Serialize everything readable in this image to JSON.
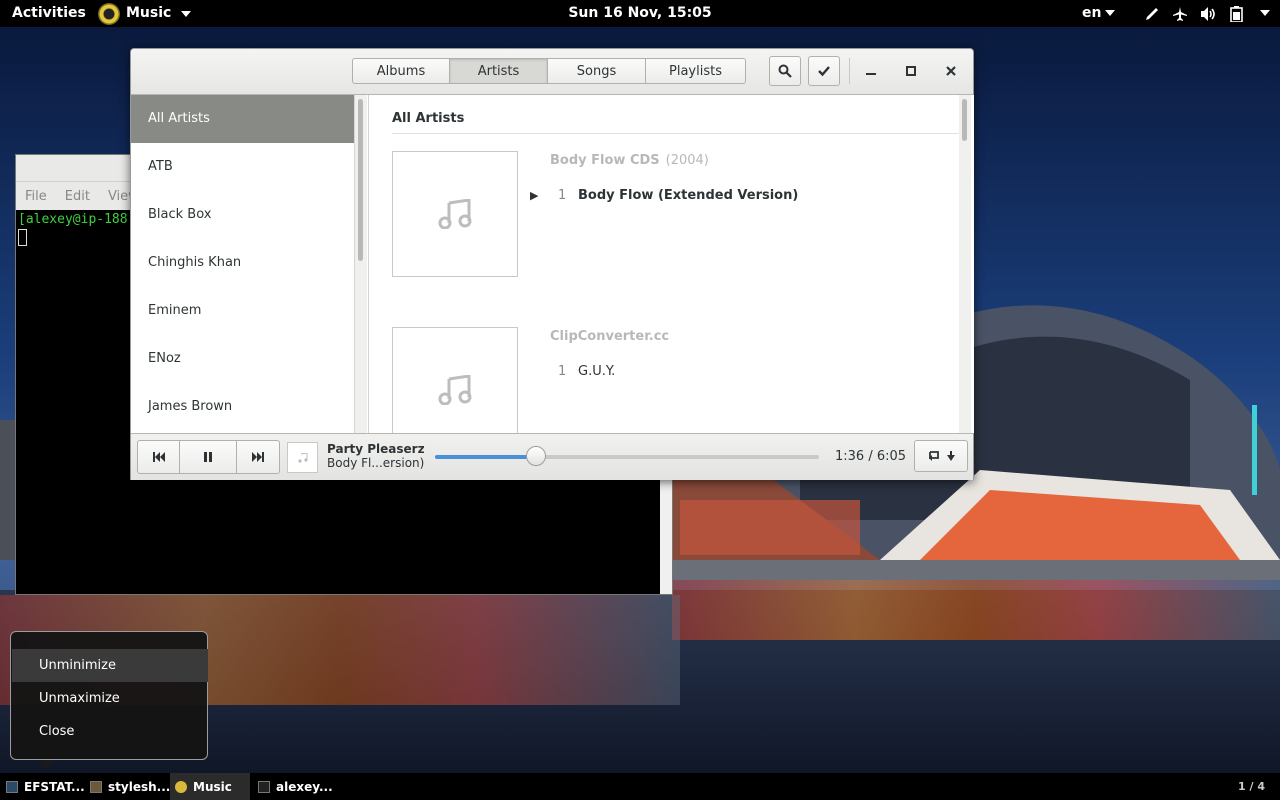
{
  "topbar": {
    "activities": "Activities",
    "app_menu": "Music",
    "clock": "Sun 16 Nov, 15:05",
    "language": "en",
    "tray_icons": [
      "pen-icon",
      "airplane-icon",
      "volume-icon",
      "battery-icon",
      "system-menu-icon"
    ]
  },
  "terminal": {
    "menu": [
      "File",
      "Edit",
      "View"
    ],
    "prompt": "[alexey@ip-188"
  },
  "music": {
    "view_tabs": [
      {
        "label": "Albums",
        "active": false
      },
      {
        "label": "Artists",
        "active": true
      },
      {
        "label": "Songs",
        "active": false
      },
      {
        "label": "Playlists",
        "active": false
      }
    ],
    "artists": [
      "All Artists",
      "ATB",
      "Black Box",
      "Chinghis Khan",
      "Eminem",
      "ENoz",
      "James Brown"
    ],
    "selected_artist": "All Artists",
    "content_heading": "All Artists",
    "albums": [
      {
        "title": "Body Flow CDS",
        "year": "(2004)",
        "tracks": [
          {
            "number": "1",
            "name": "Body Flow (Extended Version)",
            "playing": true
          }
        ]
      },
      {
        "title": "ClipConverter.cc",
        "year": "",
        "tracks": [
          {
            "number": "1",
            "name": "G.U.Y.",
            "playing": false
          }
        ]
      }
    ],
    "player": {
      "title": "Party Pleaserz",
      "artist": "Body Fl...ersion)",
      "elapsed": "1:36",
      "separator": "/",
      "total": "6:05",
      "progress_fraction": 0.263
    }
  },
  "popup": {
    "items": [
      "Unminimize",
      "Unmaximize",
      "Close"
    ],
    "highlighted": "Unminimize"
  },
  "taskbar": {
    "tasks": [
      {
        "label": "EFSTAT...",
        "active": false
      },
      {
        "label": "stylesh...",
        "active": false
      },
      {
        "label": "Music",
        "active": true
      },
      {
        "label": "alexey...",
        "active": false
      }
    ],
    "workspace": "1 / 4"
  }
}
